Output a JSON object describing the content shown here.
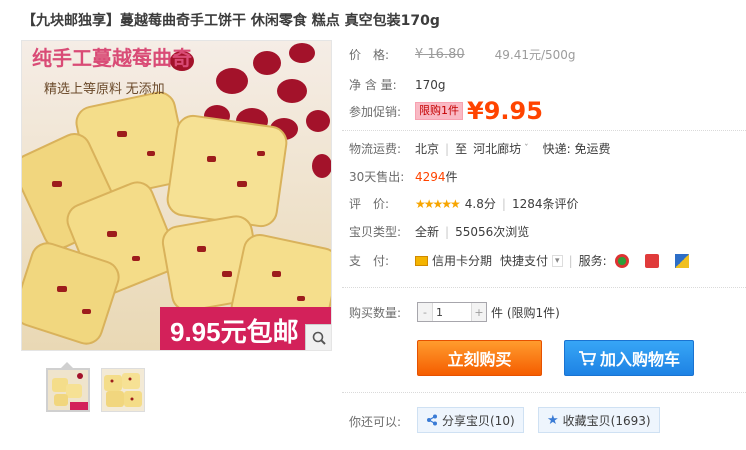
{
  "title": "【九块邮独享】蔓越莓曲奇手工饼干 休闲零食 糕点 真空包装170g",
  "image": {
    "headline": "纯手工蔓越莓曲奇",
    "subline": "精选上等原料 无添加",
    "price_banner": "9.95元包邮"
  },
  "price": {
    "label": "价　格:",
    "original": "¥ 16.80",
    "unit_price": "49.41元/500g"
  },
  "weight": {
    "label": "净 含 量:",
    "value": "170g"
  },
  "promo": {
    "label": "参加促销:",
    "tag": "限购1件",
    "currency": "¥",
    "value": "9.95"
  },
  "shipping": {
    "label": "物流运费:",
    "from": "北京",
    "to_word": "至",
    "to": "河北廊坊",
    "fee": "快递: 免运费"
  },
  "sold": {
    "label": "30天售出:",
    "count": "4294",
    "unit": "件"
  },
  "rating": {
    "label": "评　价:",
    "stars": "★★★★★",
    "score": "4.8分",
    "reviews": "1284条评价"
  },
  "condition": {
    "label": "宝贝类型:",
    "type": "全新",
    "views": "55056次浏览"
  },
  "payment": {
    "label": "支　付:",
    "credit": "信用卡分期",
    "quick": "快捷支付",
    "service_label": "服务:"
  },
  "quantity": {
    "label": "购买数量:",
    "value": "1",
    "unit": "件 (限购1件)",
    "minus": "-",
    "plus": "+"
  },
  "buttons": {
    "buy": "立刻购买",
    "cart": "加入购物车"
  },
  "share": {
    "label": "你还可以:",
    "share": "分享宝贝(10)",
    "collect": "收藏宝贝(1693)"
  },
  "colors": {
    "accent": "#ff4400",
    "buy": "#f55d00",
    "cart": "#1e82e4"
  },
  "icons": [
    "search-zoom-icon",
    "cart-icon",
    "share-icon",
    "star-icon",
    "credit-card-icon",
    "dropdown-icon",
    "service-7day-icon",
    "service-guarantee-icon",
    "service-invoice-icon"
  ]
}
